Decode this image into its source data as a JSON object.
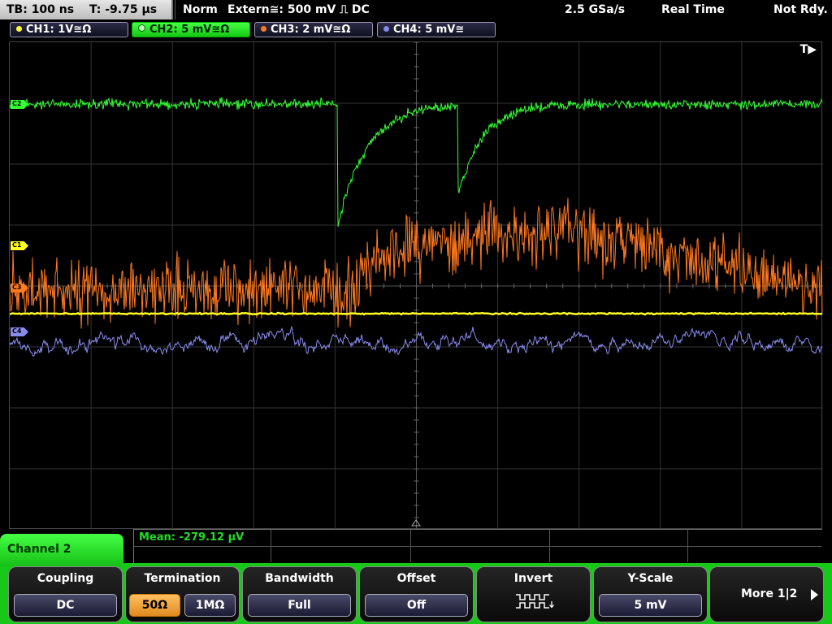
{
  "status": {
    "timebase": "TB: 100 ns",
    "trigger_time": "T: -9.75 µs",
    "mode": "Norm",
    "trigger_source": "Extern≅: 500 mV ⎍ DC",
    "sample_rate": "2.5 GSa/s",
    "acquisition": "Real Time",
    "state": "Not Rdy."
  },
  "channels": [
    {
      "label": "CH1: 1V≅Ω",
      "color": "#ffff33",
      "active": false
    },
    {
      "label": "CH2: 5 mV≅Ω",
      "color": "#33ff33",
      "active": true
    },
    {
      "label": "CH3: 2 mV≅Ω",
      "color": "#ff7722",
      "active": false
    },
    {
      "label": "CH4: 5 mV≅",
      "color": "#8888ee",
      "active": false
    }
  ],
  "markers": {
    "c1": "C1",
    "c2": "C2",
    "c3": "C3",
    "c4": "C4"
  },
  "trigger_label": "T▶",
  "measurement": {
    "mean": "Mean: -279.12 µV"
  },
  "menu": {
    "channel_label": "Channel 2",
    "coupling": {
      "title": "Coupling",
      "value": "DC"
    },
    "termination": {
      "title": "Termination",
      "selected": "50Ω",
      "other": "1MΩ"
    },
    "bandwidth": {
      "title": "Bandwidth",
      "value": "Full"
    },
    "offset": {
      "title": "Offset",
      "value": "Off"
    },
    "invert": {
      "title": "Invert",
      "icon": "invert-waveform-icon"
    },
    "yscale": {
      "title": "Y-Scale",
      "value": "5 mV"
    },
    "more": "More 1|2"
  }
}
